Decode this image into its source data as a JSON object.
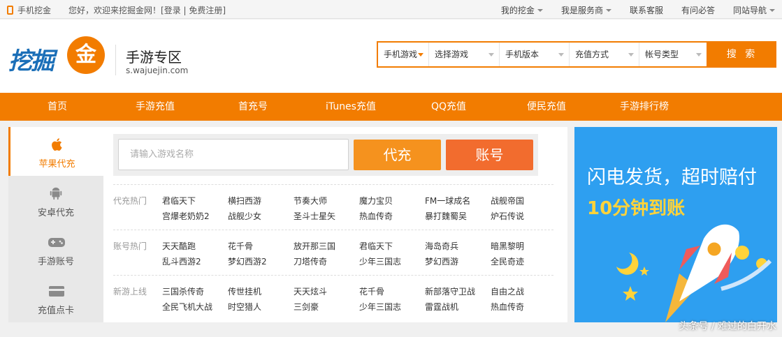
{
  "topbar": {
    "mobile": "手机挖金",
    "welcome_prefix": "您好，欢迎来挖掘金网！",
    "login": "[登录",
    "sep": " | ",
    "register": "免费注册]",
    "links": [
      "我的挖金",
      "我是服务商",
      "联系客服",
      "有问必答",
      "同站导航"
    ]
  },
  "header": {
    "logo_text": "挖掘金",
    "zone_title": "手游专区",
    "zone_url": "s.wajuejin.com",
    "search": {
      "selects": [
        "手机游戏",
        "选择游戏",
        "手机版本",
        "充值方式",
        "帐号类型"
      ],
      "button": "搜 索"
    }
  },
  "nav": [
    "首页",
    "手游充值",
    "首充号",
    "iTunes充值",
    "QQ充值",
    "便民充值",
    "手游排行榜"
  ],
  "sidebar": [
    {
      "label": "苹果代充",
      "icon": "apple-icon",
      "active": true
    },
    {
      "label": "安卓代充",
      "icon": "android-icon",
      "active": false
    },
    {
      "label": "手游账号",
      "icon": "gamepad-icon",
      "active": false
    },
    {
      "label": "充值点卡",
      "icon": "card-icon",
      "active": false
    }
  ],
  "quick": {
    "placeholder": "请输入游戏名称",
    "btn_recharge": "代充",
    "btn_account": "账号"
  },
  "groups": [
    {
      "label": "代充热门",
      "games": [
        "君临天下",
        "横扫西游",
        "节奏大师",
        "魔力宝贝",
        "FM一球成名",
        "战舰帝国",
        "宫爆老奶奶2",
        "战舰少女",
        "圣斗士星矢",
        "热血传奇",
        "暴打魏蜀吴",
        "炉石传说"
      ]
    },
    {
      "label": "账号热门",
      "games": [
        "天天酷跑",
        "花千骨",
        "放开那三国",
        "君临天下",
        "海岛奇兵",
        "暗黑黎明",
        "乱斗西游2",
        "梦幻西游2",
        "刀塔传奇",
        "少年三国志",
        "梦幻西游",
        "全民奇迹"
      ]
    },
    {
      "label": "新游上线",
      "games": [
        "三国杀传奇",
        "传世挂机",
        "天天炫斗",
        "花千骨",
        "新部落守卫战",
        "自由之战",
        "全民飞机大战",
        "时空猎人",
        "三剑豪",
        "少年三国志",
        "雷霆战机",
        "热血传奇"
      ]
    }
  ],
  "banner": {
    "line1": "闪电发货，超时赔付",
    "line2": "10分钟到账"
  },
  "watermark": "头条号 / 难过的白开水",
  "colors": {
    "accent": "#f27c00",
    "banner_bg": "#2e9ff0",
    "banner_highlight": "#ffd33a"
  }
}
